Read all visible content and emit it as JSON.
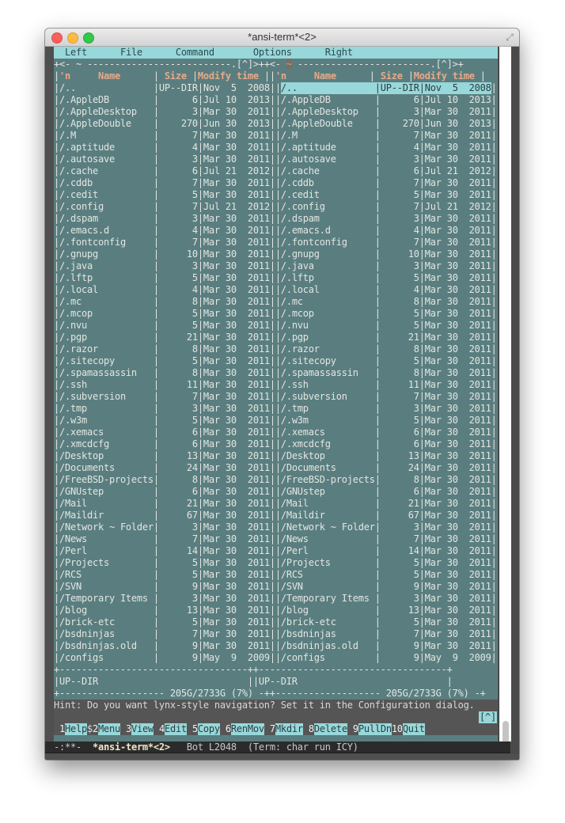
{
  "window": {
    "title": "*ansi-term*<2>"
  },
  "menu": [
    "Left",
    "File",
    "Command",
    "Options",
    "Right"
  ],
  "panels": {
    "left_path_marker": "~",
    "right_path_marker": "~",
    "history_button": "[^]",
    "columns": {
      "n": "'n",
      "name": "Name",
      "size": "Size",
      "mtime": "Modify time"
    }
  },
  "files": [
    {
      "name": "/..",
      "size": "UP--DIR",
      "month": "Nov",
      "day": "5",
      "year": "2008"
    },
    {
      "name": "/.AppleDB",
      "size": "6",
      "month": "Jul",
      "day": "10",
      "year": "2013"
    },
    {
      "name": "/.AppleDesktop",
      "size": "3",
      "month": "Mar",
      "day": "30",
      "year": "2011"
    },
    {
      "name": "/.AppleDouble",
      "size": "270",
      "month": "Jun",
      "day": "30",
      "year": "2013"
    },
    {
      "name": "/.M",
      "size": "7",
      "month": "Mar",
      "day": "30",
      "year": "2011"
    },
    {
      "name": "/.aptitude",
      "size": "4",
      "month": "Mar",
      "day": "30",
      "year": "2011"
    },
    {
      "name": "/.autosave",
      "size": "3",
      "month": "Mar",
      "day": "30",
      "year": "2011"
    },
    {
      "name": "/.cache",
      "size": "6",
      "month": "Jul",
      "day": "21",
      "year": "2012"
    },
    {
      "name": "/.cddb",
      "size": "7",
      "month": "Mar",
      "day": "30",
      "year": "2011"
    },
    {
      "name": "/.cedit",
      "size": "5",
      "month": "Mar",
      "day": "30",
      "year": "2011"
    },
    {
      "name": "/.config",
      "size": "7",
      "month": "Jul",
      "day": "21",
      "year": "2012"
    },
    {
      "name": "/.dspam",
      "size": "3",
      "month": "Mar",
      "day": "30",
      "year": "2011"
    },
    {
      "name": "/.emacs.d",
      "size": "4",
      "month": "Mar",
      "day": "30",
      "year": "2011"
    },
    {
      "name": "/.fontconfig",
      "size": "7",
      "month": "Mar",
      "day": "30",
      "year": "2011"
    },
    {
      "name": "/.gnupg",
      "size": "10",
      "month": "Mar",
      "day": "30",
      "year": "2011"
    },
    {
      "name": "/.java",
      "size": "3",
      "month": "Mar",
      "day": "30",
      "year": "2011"
    },
    {
      "name": "/.lftp",
      "size": "5",
      "month": "Mar",
      "day": "30",
      "year": "2011"
    },
    {
      "name": "/.local",
      "size": "4",
      "month": "Mar",
      "day": "30",
      "year": "2011"
    },
    {
      "name": "/.mc",
      "size": "8",
      "month": "Mar",
      "day": "30",
      "year": "2011"
    },
    {
      "name": "/.mcop",
      "size": "5",
      "month": "Mar",
      "day": "30",
      "year": "2011"
    },
    {
      "name": "/.nvu",
      "size": "5",
      "month": "Mar",
      "day": "30",
      "year": "2011"
    },
    {
      "name": "/.pgp",
      "size": "21",
      "month": "Mar",
      "day": "30",
      "year": "2011"
    },
    {
      "name": "/.razor",
      "size": "8",
      "month": "Mar",
      "day": "30",
      "year": "2011"
    },
    {
      "name": "/.sitecopy",
      "size": "5",
      "month": "Mar",
      "day": "30",
      "year": "2011"
    },
    {
      "name": "/.spamassassin",
      "size": "8",
      "month": "Mar",
      "day": "30",
      "year": "2011"
    },
    {
      "name": "/.ssh",
      "size": "11",
      "month": "Mar",
      "day": "30",
      "year": "2011"
    },
    {
      "name": "/.subversion",
      "size": "7",
      "month": "Mar",
      "day": "30",
      "year": "2011"
    },
    {
      "name": "/.tmp",
      "size": "3",
      "month": "Mar",
      "day": "30",
      "year": "2011"
    },
    {
      "name": "/.w3m",
      "size": "5",
      "month": "Mar",
      "day": "30",
      "year": "2011"
    },
    {
      "name": "/.xemacs",
      "size": "6",
      "month": "Mar",
      "day": "30",
      "year": "2011"
    },
    {
      "name": "/.xmcdcfg",
      "size": "6",
      "month": "Mar",
      "day": "30",
      "year": "2011"
    },
    {
      "name": "/Desktop",
      "size": "13",
      "month": "Mar",
      "day": "30",
      "year": "2011"
    },
    {
      "name": "/Documents",
      "size": "24",
      "month": "Mar",
      "day": "30",
      "year": "2011"
    },
    {
      "name": "/FreeBSD-projects",
      "size": "8",
      "month": "Mar",
      "day": "30",
      "year": "2011"
    },
    {
      "name": "/GNUstep",
      "size": "6",
      "month": "Mar",
      "day": "30",
      "year": "2011"
    },
    {
      "name": "/Mail",
      "size": "21",
      "month": "Mar",
      "day": "30",
      "year": "2011"
    },
    {
      "name": "/Maildir",
      "size": "67",
      "month": "Mar",
      "day": "30",
      "year": "2011"
    },
    {
      "name": "/Network ~ Folder",
      "size": "3",
      "month": "Mar",
      "day": "30",
      "year": "2011"
    },
    {
      "name": "/News",
      "size": "7",
      "month": "Mar",
      "day": "30",
      "year": "2011"
    },
    {
      "name": "/Perl",
      "size": "14",
      "month": "Mar",
      "day": "30",
      "year": "2011"
    },
    {
      "name": "/Projects",
      "size": "5",
      "month": "Mar",
      "day": "30",
      "year": "2011"
    },
    {
      "name": "/RCS",
      "size": "5",
      "month": "Mar",
      "day": "30",
      "year": "2011"
    },
    {
      "name": "/SVN",
      "size": "9",
      "month": "Mar",
      "day": "30",
      "year": "2011"
    },
    {
      "name": "/Temporary Items",
      "size": "3",
      "month": "Mar",
      "day": "30",
      "year": "2011"
    },
    {
      "name": "/blog",
      "size": "13",
      "month": "Mar",
      "day": "30",
      "year": "2011"
    },
    {
      "name": "/brick-etc",
      "size": "5",
      "month": "Mar",
      "day": "30",
      "year": "2011"
    },
    {
      "name": "/bsdninjas",
      "size": "7",
      "month": "Mar",
      "day": "30",
      "year": "2011"
    },
    {
      "name": "/bsdninjas.old",
      "size": "9",
      "month": "Mar",
      "day": "30",
      "year": "2011"
    },
    {
      "name": "/configs",
      "size": "9",
      "month": "May",
      "day": "9",
      "year": "2009"
    }
  ],
  "selected_index_right": 0,
  "status": {
    "left_mini": "UP--DIR",
    "right_mini": "UP--DIR",
    "disk_free": "205G/2733G (7%)"
  },
  "hint": "Hint: Do you want lynx-style navigation? Set it in the Configuration dialog.",
  "prompt": "$",
  "prompt_history_button": "[^]",
  "fkeys": [
    {
      "num": "1",
      "label": "Help"
    },
    {
      "num": "2",
      "label": "Menu"
    },
    {
      "num": "3",
      "label": "View"
    },
    {
      "num": "4",
      "label": "Edit"
    },
    {
      "num": "5",
      "label": "Copy"
    },
    {
      "num": "6",
      "label": "RenMov"
    },
    {
      "num": "7",
      "label": "Mkdir"
    },
    {
      "num": "8",
      "label": "Delete"
    },
    {
      "num": "9",
      "label": "PullDn"
    },
    {
      "num": "10",
      "label": "Quit"
    }
  ],
  "modeline": {
    "flags": "-:**-",
    "buffer": "*ansi-term*<2>",
    "position": "Bot L2048",
    "mode": "(Term: char run ICY)"
  }
}
